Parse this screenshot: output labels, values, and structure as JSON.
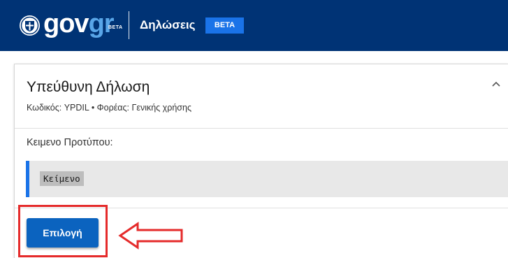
{
  "header": {
    "logo_gov": "gov",
    "logo_gr": "gr",
    "logo_beta": "BETA",
    "service_title": "Δηλώσεις",
    "beta_badge": "BETA",
    "emblem_icon": "greek-coat-of-arms-icon",
    "background_color": "#003375"
  },
  "card": {
    "title": "Υπεύθυνη Δήλωση",
    "subtitle": "Κωδικός: YPDIL • Φορέας: Γενικής χρήσης",
    "collapse_icon": "chevron-up-icon",
    "template_label": "Κειμενο Προτύπου:",
    "template_text": "Κείμενο",
    "accent_color": "#1a73e8"
  },
  "actions": {
    "select_button_label": "Επιλογή",
    "button_color": "#0b63bf"
  },
  "annotation": {
    "highlight_color": "#e52b2b",
    "arrow_icon": "left-arrow-outline-icon"
  }
}
